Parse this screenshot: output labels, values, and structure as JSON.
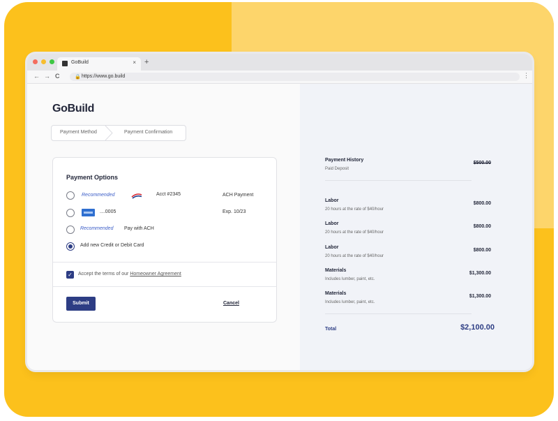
{
  "browser": {
    "tab_title": "GoBuild",
    "url": "https://www.go.build",
    "close_label": "×",
    "new_tab_label": "+",
    "back_label": "←",
    "forward_label": "→",
    "reload_label": "C",
    "lock_label": "🔒",
    "menu_label": "⋮"
  },
  "app": {
    "logo": "GoBuild"
  },
  "steps": [
    {
      "label": "Payment Method"
    },
    {
      "label": "Payment Confirmation"
    }
  ],
  "payment_options": {
    "title": "Payment Options",
    "options": [
      {
        "recommended": "Recommended",
        "account": "Acct #2345",
        "detail": "ACH Payment",
        "selected": false,
        "icon": "bank-of-america-logo"
      },
      {
        "account": "....0005",
        "detail": "Exp. 10/23",
        "selected": false,
        "icon": "card-logo"
      },
      {
        "recommended": "Recommended",
        "label": "Pay with ACH",
        "selected": false
      },
      {
        "label": "Add new Credit or Debit Card",
        "selected": true
      }
    ],
    "terms_prefix": "Accept the terms of our",
    "terms_link": "Homeowner Agreement",
    "terms_checked": true,
    "submit_label": "Submit",
    "cancel_label": "Cancel"
  },
  "summary": {
    "history_title": "Payment History",
    "history_sub": "Paid Deposit",
    "history_amount": "$500.00",
    "items": [
      {
        "title": "Labor",
        "sub": "20 hours at the rate of $40/hour",
        "amount": "$800.00"
      },
      {
        "title": "Labor",
        "sub": "20 hours at the rate of $40/hour",
        "amount": "$800.00"
      },
      {
        "title": "Labor",
        "sub": "20 hours at the rate of $40/hour",
        "amount": "$800.00"
      },
      {
        "title": "Materials",
        "sub": "Includes lumber, paint, etc.",
        "amount": "$1,300.00"
      },
      {
        "title": "Materials",
        "sub": "Includes lumber, paint, etc.",
        "amount": "$1,300.00"
      }
    ],
    "total_label": "Total",
    "total_amount": "$2,100.00"
  },
  "colors": {
    "brand": "#2d3d84",
    "accent_yellow": "#fcc11c",
    "recommended_text": "#3a5cc7"
  }
}
